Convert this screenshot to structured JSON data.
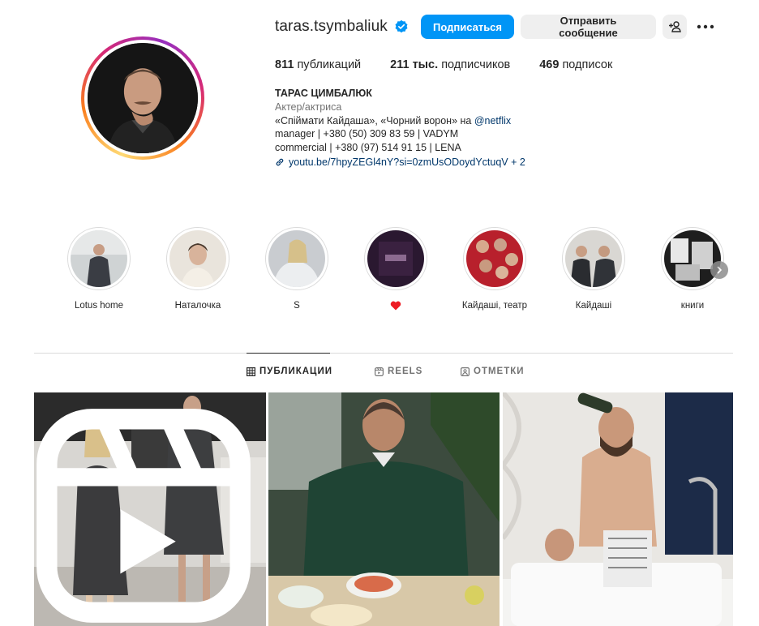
{
  "profile": {
    "username": "taras.tsymbaliuk",
    "verified": true,
    "follow_label": "Подписаться",
    "message_label": "Отправить сообщение",
    "stats": {
      "posts_count": "811",
      "posts_label": "публикаций",
      "followers_count": "211 тыс.",
      "followers_label": "подписчиков",
      "following_count": "469",
      "following_label": "подписок"
    },
    "bio": {
      "name": "ТАРАС ЦИМБАЛЮК",
      "category": "Актер/актриса",
      "line1_text": "«Спіймати Кайдаша», «Чорний ворон» на ",
      "line1_mention": "@netflix",
      "line2": "manager | +380 (50) 309 83 59 | VADYM",
      "line3": "commercial | +380 (97) 514 91 15 | LENA",
      "link": "youtu.be/7hpyZEGl4nY?si=0zmUsODoydYctuqV + 2"
    }
  },
  "highlights": [
    {
      "label": "Lotus home"
    },
    {
      "label": "Наталочка"
    },
    {
      "label": "S"
    },
    {
      "label": "",
      "icon": "red-heart-icon"
    },
    {
      "label": "Кайдаші, театр"
    },
    {
      "label": "Кайдаші"
    },
    {
      "label": "книги"
    }
  ],
  "tabs": {
    "posts": "ПУБЛИКАЦИИ",
    "reels": "REELS",
    "tagged": "ОТМЕТКИ",
    "active": "posts"
  },
  "colors": {
    "accent": "#0095f6",
    "verified": "#0095f6",
    "link": "#00376b",
    "secondary_text": "#737373",
    "button_gray": "#efefef",
    "heart": "#ed1c24"
  }
}
